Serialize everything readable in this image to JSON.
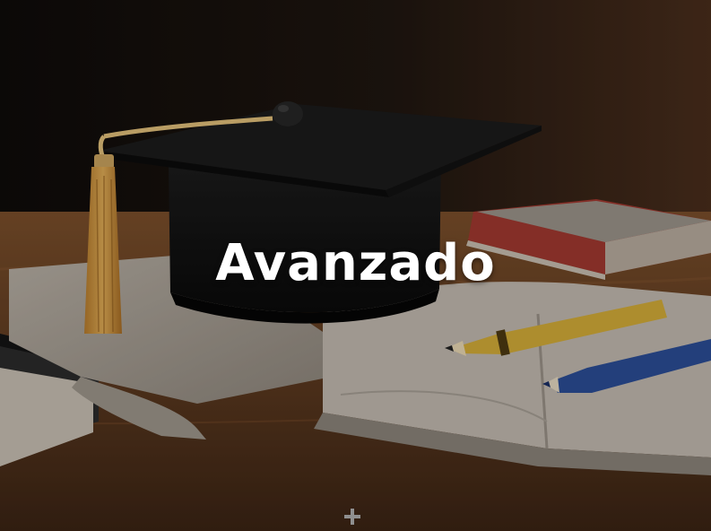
{
  "card": {
    "title": "Avanzado",
    "image_icon": "graduation-cap-books-image",
    "expand_icon": "plus-icon"
  },
  "colors": {
    "title_text": "#ffffff",
    "wall": "#2a1c13",
    "desk": "#6e4424",
    "cap": "#111111",
    "tassel": "#d9a24a",
    "red_book": "#a83a32",
    "yellow_pencil": "#d9b33b",
    "blue_pencil": "#2c4f96"
  }
}
